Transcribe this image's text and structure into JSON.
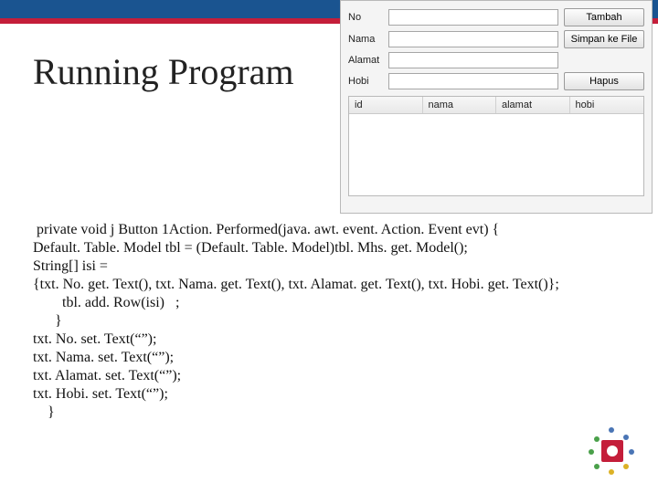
{
  "slide": {
    "title": "Running Program"
  },
  "app": {
    "labels": {
      "no": "No",
      "nama": "Nama",
      "alamat": "Alamat",
      "hobi": "Hobi"
    },
    "buttons": {
      "tambah": "Tambah",
      "simpan": "Simpan ke File",
      "hapus": "Hapus"
    },
    "columns": {
      "id": "id",
      "nama": "nama",
      "alamat": "alamat",
      "hobi": "hobi"
    }
  },
  "code": {
    "l1": " private void j Button 1Action. Performed(java. awt. event. Action. Event evt) {",
    "l2": "Default. Table. Model tbl = (Default. Table. Model)tbl. Mhs. get. Model();",
    "l3": "String[] isi =",
    "l4": "{txt. No. get. Text(), txt. Nama. get. Text(), txt. Alamat. get. Text(), txt. Hobi. get. Text()};",
    "l5": "        tbl. add. Row(isi)   ;",
    "l6": "      }",
    "l7": "txt. No. set. Text(“”);",
    "l8": "txt. Nama. set. Text(“”);",
    "l9": "txt. Alamat. set. Text(“”);",
    "l10": "txt. Hobi. set. Text(“”);",
    "l11": "    }"
  }
}
